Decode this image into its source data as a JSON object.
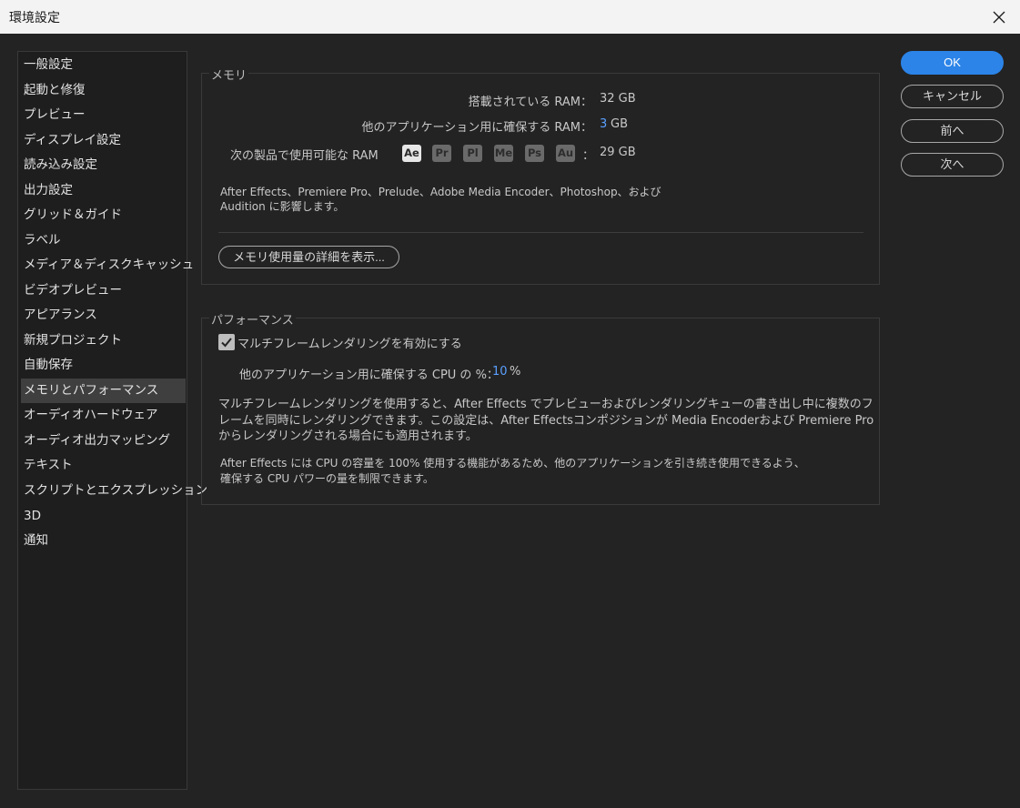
{
  "window": {
    "title": "環境設定"
  },
  "sidebar": {
    "items": [
      "一般設定",
      "起動と修復",
      "プレビュー",
      "ディスプレイ設定",
      "読み込み設定",
      "出力設定",
      "グリッド＆ガイド",
      "ラベル",
      "メディア＆ディスクキャッシュ",
      "ビデオプレビュー",
      "アピアランス",
      "新規プロジェクト",
      "自動保存",
      "メモリとパフォーマンス",
      "オーディオハードウェア",
      "オーディオ出力マッピング",
      "テキスト",
      "スクリプトとエクスプレッション",
      "3D",
      "通知"
    ],
    "active_index": 13
  },
  "memory": {
    "group_label": "メモリ",
    "installed_label": "搭載されている RAM：",
    "installed_value": "32 GB",
    "reserved_label": "他のアプリケーション用に確保する RAM：",
    "reserved_value": "3",
    "reserved_unit": "GB",
    "available_label": "次の製品で使用可能な RAM",
    "products": [
      "Ae",
      "Pr",
      "Pl",
      "Me",
      "Ps",
      "Au"
    ],
    "colon": "：",
    "available_value": "29 GB",
    "description_line1": "After Effects、Premiere Pro、Prelude、Adobe Media Encoder、Photoshop、および",
    "description_line2": "Audition に影響します。",
    "details_button": "メモリ使用量の詳細を表示..."
  },
  "performance": {
    "group_label": "パフォーマンス",
    "mfr_checkbox_label": "マルチフレームレンダリングを有効にする",
    "mfr_checked": true,
    "cpu_label": "他のアプリケーション用に確保する CPU の %：",
    "cpu_value": "10",
    "cpu_unit": "%",
    "desc1_line1": "マルチフレームレンダリングを使用すると、After Effects でプレビューおよびレンダリングキューの書き出し中に複数のフ",
    "desc1_line2": "レームを同時にレンダリングできます。この設定は、After Effectsコンポジションが Media Encoderおよび Premiere Pro",
    "desc1_line3": "からレンダリングされる場合にも適用されます。",
    "desc2_line1": "After Effects には CPU の容量を 100% 使用する機能があるため、他のアプリケーションを引き続き使用できるよう、",
    "desc2_line2": "確保する CPU パワーの量を制限できます。"
  },
  "buttons": {
    "ok": "OK",
    "cancel": "キャンセル",
    "prev": "前へ",
    "next": "次へ"
  },
  "colors": {
    "accent": "#2c84e8",
    "link_value": "#5aa0ff",
    "background": "#232323"
  }
}
